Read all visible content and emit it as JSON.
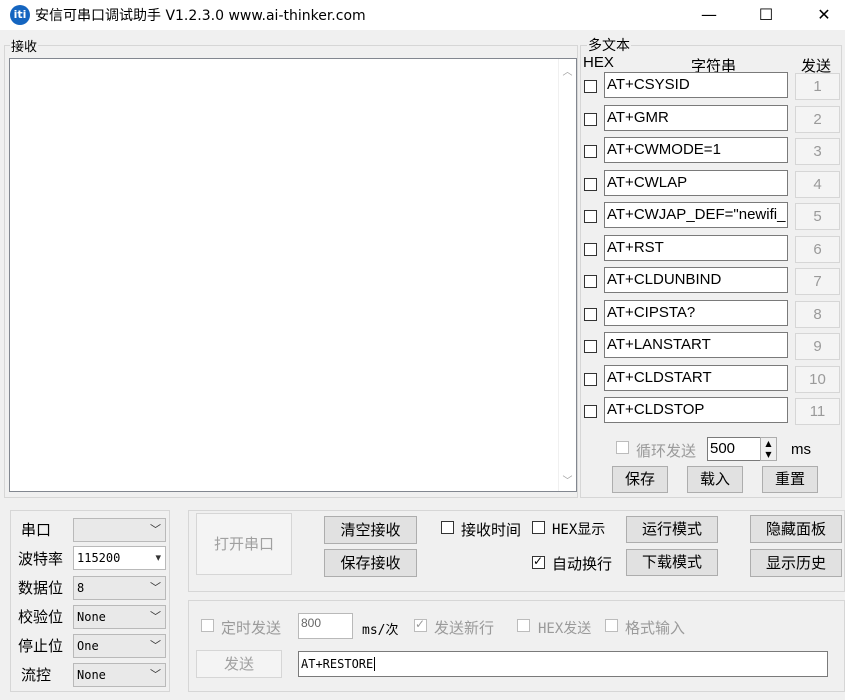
{
  "window": {
    "logo_text": "iti",
    "title": "安信可串口调试助手 V1.2.3.0    www.ai-thinker.com",
    "minimize": "—",
    "maximize": "☐",
    "close": "✕"
  },
  "receive": {
    "label": "接收"
  },
  "multitext": {
    "label": "多文本",
    "col_hex": "HEX",
    "col_string": "字符串",
    "col_send": "发送",
    "rows": [
      {
        "text": "AT+CSYSID",
        "btn": "1"
      },
      {
        "text": "AT+GMR",
        "btn": "2"
      },
      {
        "text": "AT+CWMODE=1",
        "btn": "3"
      },
      {
        "text": "AT+CWLAP",
        "btn": "4"
      },
      {
        "text": "AT+CWJAP_DEF=\"newifi_",
        "btn": "5"
      },
      {
        "text": "AT+RST",
        "btn": "6"
      },
      {
        "text": "AT+CLDUNBIND",
        "btn": "7"
      },
      {
        "text": "AT+CIPSTA?",
        "btn": "8"
      },
      {
        "text": "AT+LANSTART",
        "btn": "9"
      },
      {
        "text": "AT+CLDSTART",
        "btn": "10"
      },
      {
        "text": "AT+CLDSTOP",
        "btn": "11"
      }
    ],
    "loop_send_label": "循环发送",
    "loop_interval": "500",
    "loop_unit": "ms",
    "save": "保存",
    "load": "载入",
    "reset": "重置"
  },
  "port_settings": {
    "port_label": "串口",
    "port_value": "",
    "baud_label": "波特率",
    "baud_value": "115200",
    "databits_label": "数据位",
    "databits_value": "8",
    "parity_label": "校验位",
    "parity_value": "None",
    "stopbits_label": "停止位",
    "stopbits_value": "One",
    "flow_label": "流控",
    "flow_value": "None"
  },
  "controls": {
    "open_port": "打开串口",
    "clear_recv": "清空接收",
    "save_recv": "保存接收",
    "recv_time": "接收时间",
    "hex_display": "HEX显示",
    "run_mode": "运行模式",
    "hide_panel": "隐藏面板",
    "auto_newline": "自动换行",
    "download_mode": "下载模式",
    "show_history": "显示历史"
  },
  "send_area": {
    "timed_send": "定时发送",
    "interval": "800",
    "interval_unit": "ms/次",
    "send_newline": "发送新行",
    "hex_send": "HEX发送",
    "format_input": "格式输入",
    "send_button": "发送",
    "send_text": "AT+RESTORE"
  }
}
